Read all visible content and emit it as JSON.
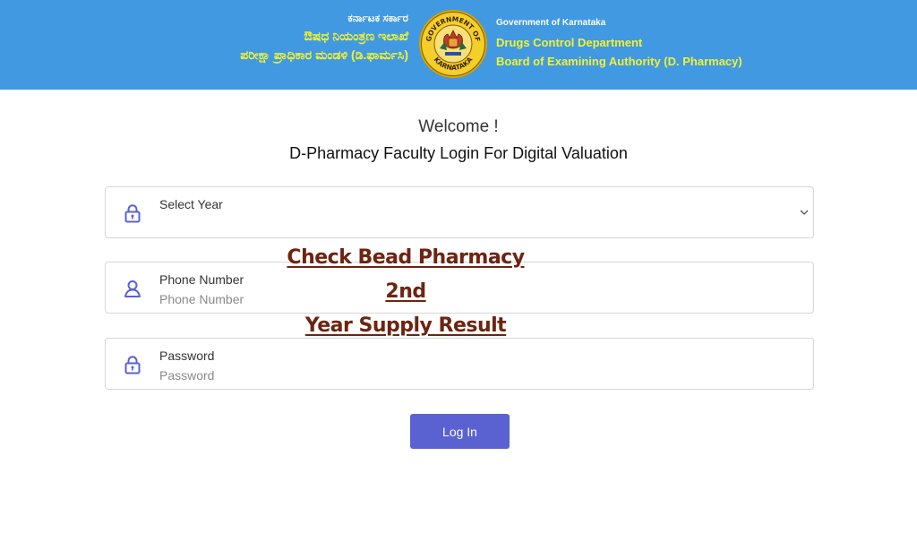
{
  "header": {
    "kannada_line1": "ಕರ್ನಾಟಕ ಸರ್ಕಾರ",
    "kannada_line2": "ಔಷಧ ನಿಯಂತ್ರಣ ಇಲಾಖೆ",
    "kannada_line3": "ಪರೀಕ್ಷಾ ಪ್ರಾಧಿಕಾರ ಮಂಡಳಿ (ಡಿ.ಫಾರ್ಮಸಿ)",
    "english_line1": "Government of Karnataka",
    "english_line2": "Drugs Control Department",
    "english_line3": "Board of Examining Authority (D. Pharmacy)",
    "emblem_top_text": "GOVERNMENT OF",
    "emblem_bottom_text": "KARNATAKA",
    "background_color": "#4199e1",
    "text_color": "#f2f233"
  },
  "main": {
    "welcome": "Welcome !",
    "subtitle": "D-Pharmacy Faculty Login For Digital Valuation"
  },
  "form": {
    "year": {
      "label": "Select Year",
      "value": "",
      "icon": "lock-icon"
    },
    "phone": {
      "label": "Phone Number",
      "placeholder": "Phone Number",
      "value": "",
      "icon": "user-icon"
    },
    "password": {
      "label": "Password",
      "placeholder": "Password",
      "value": "",
      "icon": "lock-icon"
    },
    "login_label": "Log In",
    "accent_color": "#5a62d2"
  },
  "overlay": {
    "line1": "Check Bead Pharmacy 2nd",
    "line2": "Year Supply Result",
    "color": "#6d2410"
  }
}
